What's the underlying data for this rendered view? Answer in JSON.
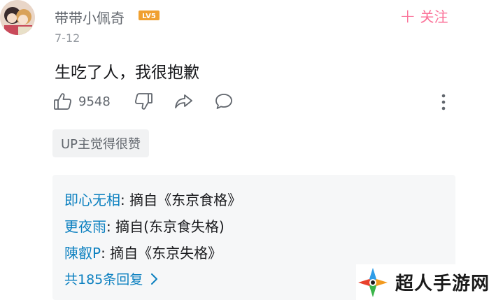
{
  "comment": {
    "username": "带带小佩奇",
    "level": "LV5",
    "date": "7-12",
    "text": "生吃了人，我很抱歉",
    "like_count": "9548",
    "follow_label": "关注",
    "up_liked_badge": "UP主觉得很赞"
  },
  "replies": [
    {
      "user": "即心无相",
      "text": ": 摘自《东京食格》"
    },
    {
      "user": "更夜雨",
      "text": ": 摘自(东京食失格)"
    },
    {
      "user": "陳叡P",
      "text": ": 摘自《东京失格》"
    }
  ],
  "replies_total": "共185条回复",
  "watermark": {
    "text": "超人手游网"
  },
  "colors": {
    "accent": "#fb7299",
    "link": "#0c80c0",
    "level_badge": "#f0a030"
  }
}
